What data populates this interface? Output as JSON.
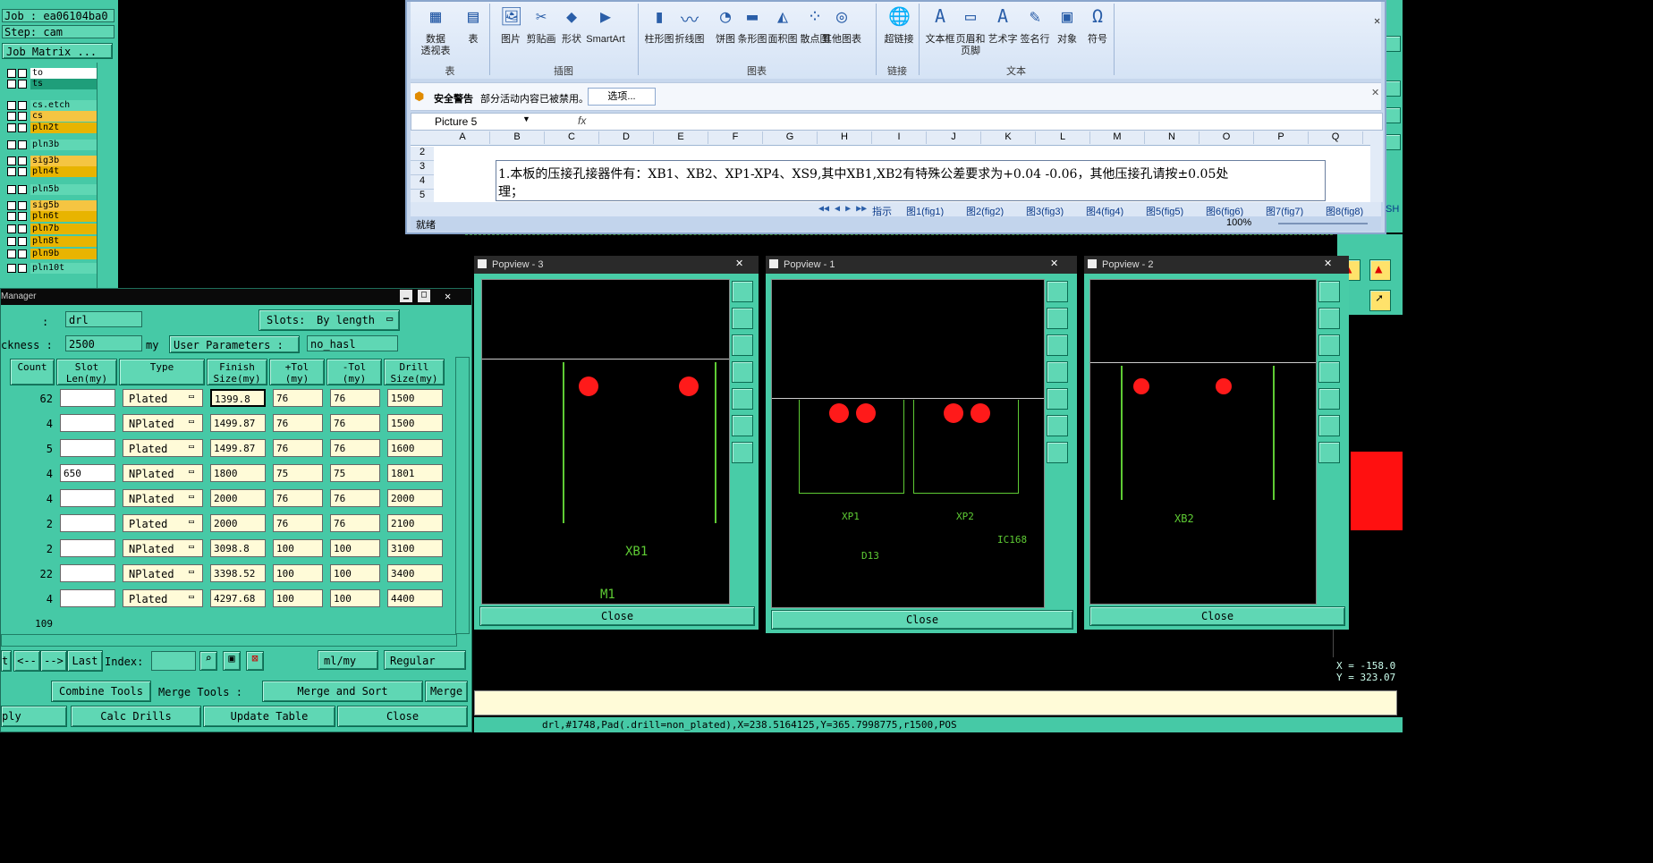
{
  "job_panel": {
    "job_label": "Job : ea06104ba0",
    "step_label": "Step: cam",
    "matrix_button": "Job Matrix ...",
    "layers": [
      {
        "name": "to",
        "color": "#ffffff"
      },
      {
        "name": "ts",
        "color": "#1f9e7a"
      },
      {
        "name": "cs.etch",
        "color": "#5fd7b4"
      },
      {
        "name": "cs",
        "color": "#f5c542"
      },
      {
        "name": "pln2t",
        "color": "#e8b400"
      },
      {
        "name": "pln3b",
        "color": "#5fd7b4"
      },
      {
        "name": "sig3b",
        "color": "#f5c542"
      },
      {
        "name": "pln4t",
        "color": "#e8b400"
      },
      {
        "name": "pln5b",
        "color": "#5fd7b4"
      },
      {
        "name": "sig5b",
        "color": "#f5c542"
      },
      {
        "name": "pln6t",
        "color": "#e8b400"
      },
      {
        "name": "pln7b",
        "color": "#e8b400"
      },
      {
        "name": "pln8t",
        "color": "#e8b400"
      },
      {
        "name": "pln9b",
        "color": "#e8b400"
      },
      {
        "name": "pln10t",
        "color": "#5fd7b4"
      }
    ]
  },
  "excel": {
    "ribbon_buttons": [
      {
        "label": "数据\n透视表",
        "icon": "pivot-table-icon"
      },
      {
        "label": "表",
        "icon": "table-icon"
      },
      {
        "label": "图片",
        "icon": "picture-icon"
      },
      {
        "label": "剪贴画",
        "icon": "clipart-icon"
      },
      {
        "label": "形状",
        "icon": "shapes-icon"
      },
      {
        "label": "SmartArt",
        "icon": "smartart-icon"
      },
      {
        "label": "柱形图",
        "icon": "column-chart-icon"
      },
      {
        "label": "折线图",
        "icon": "line-chart-icon"
      },
      {
        "label": "饼图",
        "icon": "pie-chart-icon"
      },
      {
        "label": "条形图",
        "icon": "bar-chart-icon"
      },
      {
        "label": "面积图",
        "icon": "area-chart-icon"
      },
      {
        "label": "散点图",
        "icon": "scatter-chart-icon"
      },
      {
        "label": "其他图表",
        "icon": "other-chart-icon"
      },
      {
        "label": "超链接",
        "icon": "hyperlink-icon"
      },
      {
        "label": "文本框",
        "icon": "textbox-icon"
      },
      {
        "label": "页眉和\n页脚",
        "icon": "header-footer-icon"
      },
      {
        "label": "艺术字",
        "icon": "wordart-icon"
      },
      {
        "label": "签名行",
        "icon": "signature-icon"
      },
      {
        "label": "对象",
        "icon": "object-icon"
      },
      {
        "label": "符号",
        "icon": "symbol-icon"
      }
    ],
    "groups": [
      "表",
      "插图",
      "图表",
      "链接",
      "文本"
    ],
    "security_title": "安全警告",
    "security_text": "部分活动内容已被禁用。",
    "options_button": "选项...",
    "name_box": "Picture 5",
    "fx": "fx",
    "columns": [
      "A",
      "B",
      "C",
      "D",
      "E",
      "F",
      "G",
      "H",
      "I",
      "J",
      "K",
      "L",
      "M",
      "N",
      "O",
      "P",
      "Q"
    ],
    "rows": [
      "2",
      "3",
      "4",
      "5"
    ],
    "note_line1": "1.本板的压接孔接器件有：XB1、XB2、XP1-XP4、XS9,其中XB1,XB2有特殊公差要求为+0.04 -0.06，其他压接孔请按±0.05处",
    "note_line2": "理；",
    "sheet_tabs": [
      "指示",
      "图1(fig1)",
      "图2(fig2)",
      "图3(fig3)",
      "图4(fig4)",
      "图5(fig5)",
      "图6(fig6)",
      "图7(fig7)",
      "图8(fig8)",
      "SH"
    ],
    "status": "就绪",
    "zoom": "100%"
  },
  "tool_manager": {
    "title": "Manager",
    "name_label": ":",
    "name_value": "drl",
    "slots_label": "Slots:",
    "slots_value": "By length",
    "thickness_label": "ckness :",
    "thickness_value": "2500",
    "thickness_unit": "my",
    "user_params_label": "User Parameters :",
    "user_params_value": "no_hasl",
    "headers": [
      "Count",
      "Slot\nLen(my)",
      "Type",
      "Finish\nSize(my)",
      "+Tol\n(my)",
      "-Tol\n(my)",
      "Drill\nSize(my)"
    ],
    "rows": [
      {
        "count": "62",
        "slot": "",
        "type": "Plated",
        "finish": "1399.8",
        "ptol": "76",
        "mtol": "76",
        "drill": "1500"
      },
      {
        "count": "4",
        "slot": "",
        "type": "NPlated",
        "finish": "1499.87",
        "ptol": "76",
        "mtol": "76",
        "drill": "1500"
      },
      {
        "count": "5",
        "slot": "",
        "type": "Plated",
        "finish": "1499.87",
        "ptol": "76",
        "mtol": "76",
        "drill": "1600"
      },
      {
        "count": "4",
        "slot": "650",
        "type": "NPlated",
        "finish": "1800",
        "ptol": "75",
        "mtol": "75",
        "drill": "1801"
      },
      {
        "count": "4",
        "slot": "",
        "type": "NPlated",
        "finish": "2000",
        "ptol": "76",
        "mtol": "76",
        "drill": "2000"
      },
      {
        "count": "2",
        "slot": "",
        "type": "Plated",
        "finish": "2000",
        "ptol": "76",
        "mtol": "76",
        "drill": "2100"
      },
      {
        "count": "2",
        "slot": "",
        "type": "NPlated",
        "finish": "3098.8",
        "ptol": "100",
        "mtol": "100",
        "drill": "3100"
      },
      {
        "count": "22",
        "slot": "",
        "type": "NPlated",
        "finish": "3398.52",
        "ptol": "100",
        "mtol": "100",
        "drill": "3400"
      },
      {
        "count": "4",
        "slot": "",
        "type": "Plated",
        "finish": "4297.68",
        "ptol": "100",
        "mtol": "100",
        "drill": "4400"
      }
    ],
    "total": "109",
    "nav": {
      "t": "t",
      "prev": "<--",
      "next": "-->",
      "last": "Last",
      "index_label": "Index:",
      "units": "ml/my",
      "mode": "Regular"
    },
    "row2": {
      "combine": "Combine Tools",
      "merge_tools": "Merge Tools :",
      "merge_sort": "Merge and Sort",
      "merge": "Merge"
    },
    "row3": {
      "apply": "ply",
      "calc": "Calc Drills",
      "update": "Update Table",
      "close": "Close"
    }
  },
  "popviews": [
    {
      "title": "Popview - 3",
      "label1": "XB1",
      "label2": "M1",
      "close": "Close"
    },
    {
      "title": "Popview - 1",
      "label1": "XP1",
      "label2": "XP2",
      "label3": "D13",
      "label4": "IC168",
      "close": "Close"
    },
    {
      "title": "Popview - 2",
      "label1": "XB2",
      "close": "Close"
    }
  ],
  "coords": {
    "x": "X = -158.0",
    "y": "Y = 323.07"
  },
  "status_line": "drl,#1748,Pad(.drill=non_plated),X=238.5164125,Y=365.7998775,r1500,POS"
}
